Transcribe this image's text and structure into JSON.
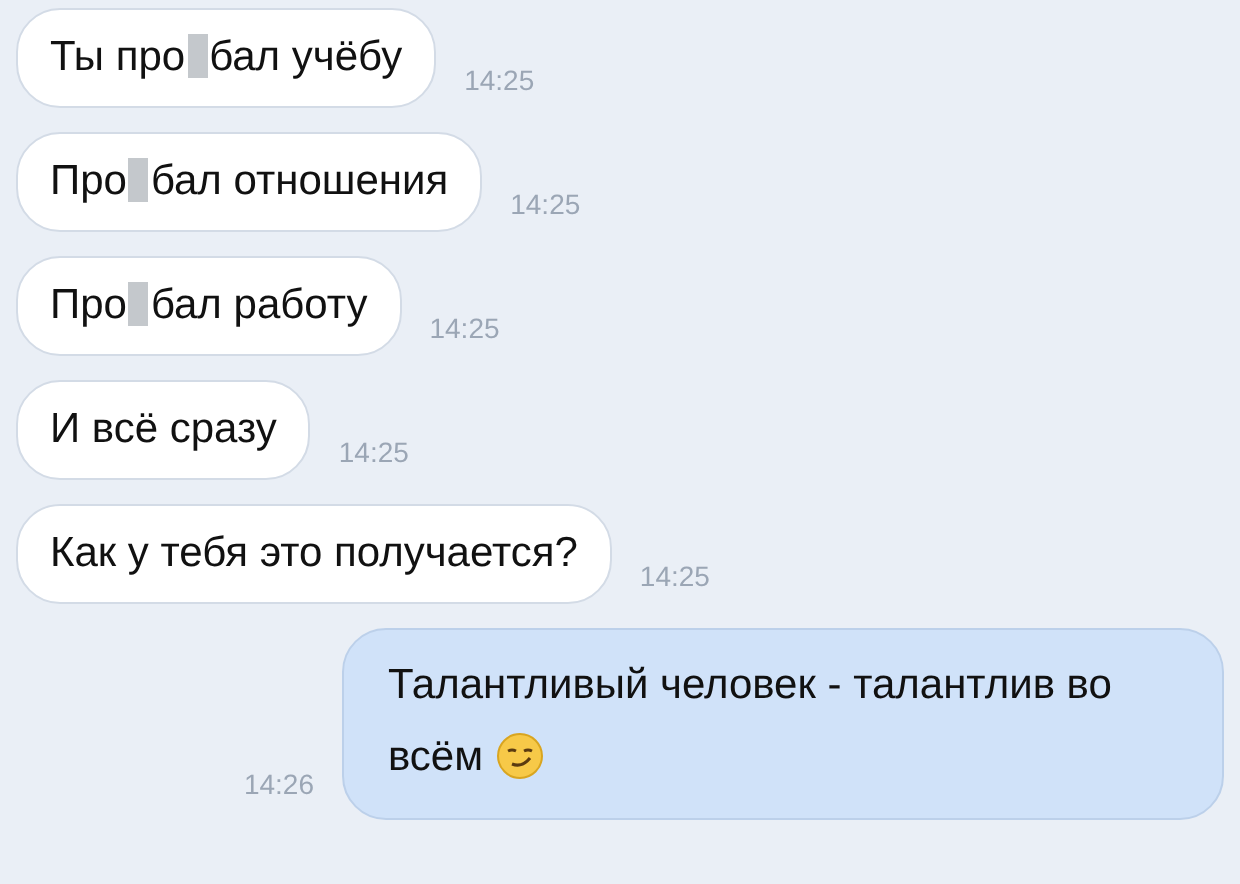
{
  "messages": [
    {
      "kind": "incoming",
      "time": "14:25",
      "segments": [
        {
          "kind": "text",
          "text": "Ты про"
        },
        {
          "kind": "censor"
        },
        {
          "kind": "text",
          "text": "бал учёбу"
        }
      ]
    },
    {
      "kind": "incoming",
      "time": "14:25",
      "segments": [
        {
          "kind": "text",
          "text": "Про"
        },
        {
          "kind": "censor"
        },
        {
          "kind": "text",
          "text": "бал отношения"
        }
      ]
    },
    {
      "kind": "incoming",
      "time": "14:25",
      "segments": [
        {
          "kind": "text",
          "text": "Про"
        },
        {
          "kind": "censor"
        },
        {
          "kind": "text",
          "text": "бал работу"
        }
      ]
    },
    {
      "kind": "incoming",
      "time": "14:25",
      "segments": [
        {
          "kind": "text",
          "text": "И всё сразу"
        }
      ]
    },
    {
      "kind": "incoming",
      "time": "14:25",
      "segments": [
        {
          "kind": "text",
          "text": "Как у тебя это получается?"
        }
      ]
    },
    {
      "kind": "outgoing",
      "time": "14:26",
      "segments": [
        {
          "kind": "text",
          "text": "Талантливый человек - талантлив во"
        },
        {
          "kind": "break"
        },
        {
          "kind": "text",
          "text": "всём"
        },
        {
          "kind": "emoji"
        }
      ]
    }
  ]
}
